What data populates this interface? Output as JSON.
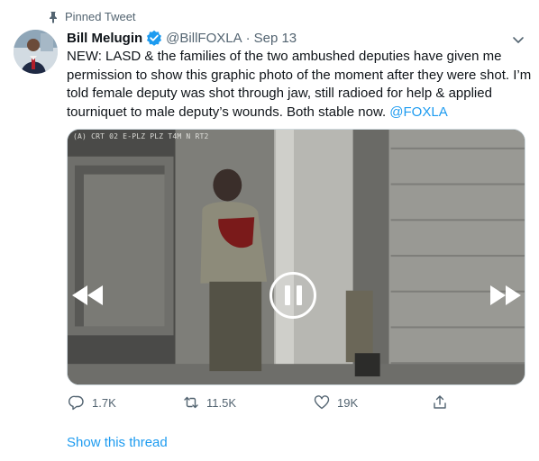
{
  "context": {
    "label": "Pinned Tweet",
    "icon": "pin-icon"
  },
  "author": {
    "name": "Bill Melugin",
    "handle": "@BillFOXLA",
    "separator": "·",
    "date": "Sep 13",
    "verified": true
  },
  "tweet": {
    "text_main": "NEW: LASD & the families of the two ambushed deputies have given me permission to show this graphic photo of the moment after they were shot. I’m told female deputy was shot through jaw, still radioed for help & applied tourniquet to male deputy’s wounds. Both stable now. ",
    "mention": "@FOXLA"
  },
  "media": {
    "overlay_text": "(A) CRT 02 E-PLZ PLZ T4M N RT2",
    "controls": [
      "rewind-icon",
      "pause-icon",
      "fast-forward-icon"
    ]
  },
  "actions": {
    "reply_count": "1.7K",
    "retweet_count": "11.5K",
    "like_count": "19K",
    "share_icon": "share-icon"
  },
  "thread": {
    "label": "Show this thread"
  },
  "colors": {
    "accent": "#1d9bf0",
    "secondary_text": "#536471",
    "primary_text": "#0f1419"
  }
}
